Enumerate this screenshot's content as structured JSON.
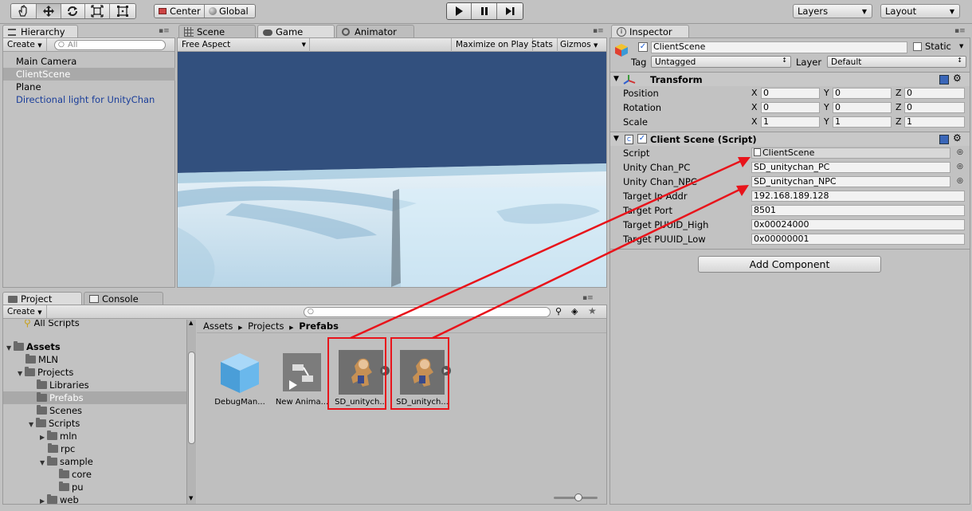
{
  "toolbar": {
    "pivot_center": "Center",
    "pivot_global": "Global",
    "layers_label": "Layers",
    "layout_label": "Layout"
  },
  "hierarchy": {
    "tab": "Hierarchy",
    "create": "Create",
    "search_placeholder": "All",
    "items": [
      "Main Camera",
      "ClientScene",
      "Plane",
      "Directional light for UnityChan"
    ],
    "selected_index": 1
  },
  "scene_tabs": {
    "scene": "Scene",
    "game": "Game",
    "animator": "Animator"
  },
  "game": {
    "aspect": "Free Aspect",
    "maximize": "Maximize on Play",
    "stats": "Stats",
    "gizmos": "Gizmos"
  },
  "inspector": {
    "tab": "Inspector",
    "object_name": "ClientScene",
    "static_label": "Static",
    "tag_label": "Tag",
    "tag_value": "Untagged",
    "layer_label": "Layer",
    "layer_value": "Default",
    "transform": {
      "title": "Transform",
      "position": {
        "label": "Position",
        "x": "0",
        "y": "0",
        "z": "0"
      },
      "rotation": {
        "label": "Rotation",
        "x": "0",
        "y": "0",
        "z": "0"
      },
      "scale": {
        "label": "Scale",
        "x": "1",
        "y": "1",
        "z": "1"
      }
    },
    "script_component": {
      "title": "Client Scene (Script)",
      "fields": [
        {
          "label": "Script",
          "value": "ClientScene"
        },
        {
          "label": "Unity Chan_PC",
          "value": "SD_unitychan_PC"
        },
        {
          "label": "Unity Chan_NPC",
          "value": "SD_unitychan_NPC"
        },
        {
          "label": "Target Ip Addr",
          "value": "192.168.189.128"
        },
        {
          "label": "Target Port",
          "value": "8501"
        },
        {
          "label": "Target PUUID_High",
          "value": "0x00024000"
        },
        {
          "label": "Target PUUID_Low",
          "value": "0x00000001"
        }
      ]
    },
    "add_component": "Add Component"
  },
  "project": {
    "tab": "Project",
    "console_tab": "Console",
    "create": "Create",
    "tree": [
      {
        "label": "All Scripts"
      },
      {
        "label": "Assets"
      },
      {
        "label": "MLN"
      },
      {
        "label": "Projects"
      },
      {
        "label": "Libraries"
      },
      {
        "label": "Prefabs"
      },
      {
        "label": "Scenes"
      },
      {
        "label": "Scripts"
      },
      {
        "label": "mln"
      },
      {
        "label": "rpc"
      },
      {
        "label": "sample"
      },
      {
        "label": "core"
      },
      {
        "label": "pu"
      },
      {
        "label": "web"
      }
    ],
    "breadcrumb": [
      "Assets",
      "Projects",
      "Prefabs"
    ],
    "assets": [
      {
        "name": "DebugMan..."
      },
      {
        "name": "New Anima..."
      },
      {
        "name": "SD_unitych..."
      },
      {
        "name": "SD_unitych..."
      }
    ]
  },
  "colors": {
    "annotation": "#e8141b",
    "sky": "#32507e",
    "selection": "#a9a9a9"
  }
}
